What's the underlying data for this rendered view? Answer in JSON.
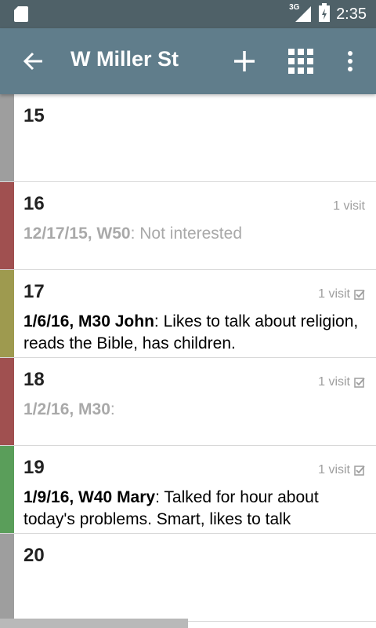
{
  "status": {
    "network": "3G",
    "time": "2:35"
  },
  "appbar": {
    "title": "W Miller St",
    "icons": [
      "back-arrow-icon",
      "add-icon",
      "grid-icon",
      "more-vertical-icon"
    ]
  },
  "houses": [
    {
      "number": "15",
      "color": "#9e9e9e",
      "visits": "",
      "checked": false,
      "note_head": "",
      "note_text": "",
      "muted": false
    },
    {
      "number": "16",
      "color": "#a05050",
      "visits": "1 visit",
      "checked": false,
      "note_head": "12/17/15, W50",
      "note_text": ": Not interested",
      "muted": true
    },
    {
      "number": "17",
      "color": "#9e9a4f",
      "visits": "1 visit",
      "checked": true,
      "note_head": "1/6/16, M30 John",
      "note_text": ": Likes to talk about religion, reads the Bible, has children.",
      "muted": false
    },
    {
      "number": "18",
      "color": "#a05050",
      "visits": "1 visit",
      "checked": true,
      "note_head": "1/2/16, M30",
      "note_text": ":",
      "muted": true
    },
    {
      "number": "19",
      "color": "#5a9e5a",
      "visits": "1 visit",
      "checked": true,
      "note_head": "1/9/16, W40 Mary",
      "note_text": ": Talked for hour about today's problems. Smart, likes to talk",
      "muted": false
    },
    {
      "number": "20",
      "color": "#9e9e9e",
      "visits": "",
      "checked": false,
      "note_head": "",
      "note_text": "",
      "muted": false
    }
  ]
}
